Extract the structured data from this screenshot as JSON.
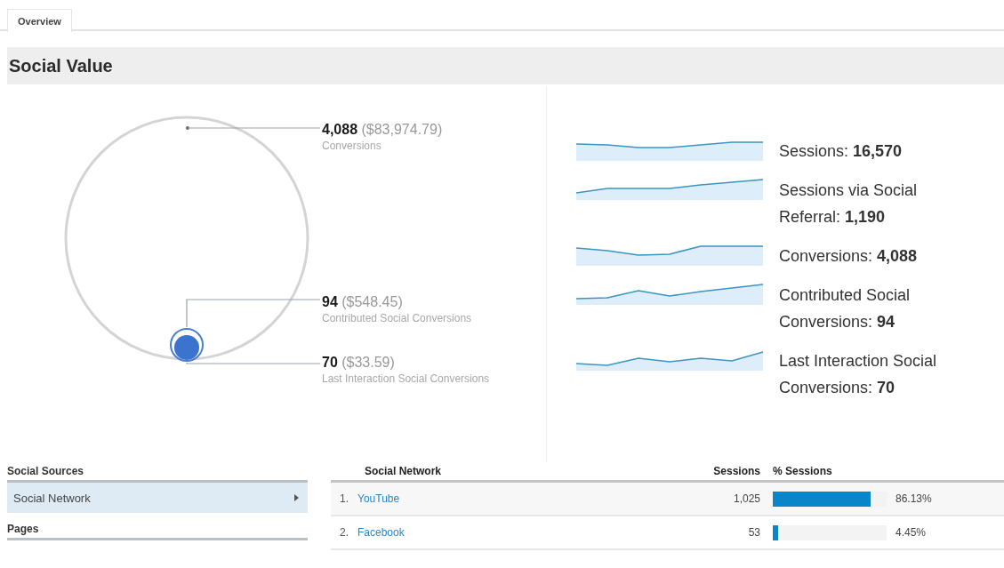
{
  "tabs": [
    {
      "label": "Overview",
      "selected": true
    }
  ],
  "header": {
    "title": "Social Value"
  },
  "circle_labels": [
    {
      "figure": "**4,088** ($83,974.79)",
      "caption": "Conversions"
    },
    {
      "figure": "**94** ($548.45)",
      "caption": "Contributed Social Conversions"
    },
    {
      "figure": "**70** ($33.59)",
      "caption": "Last Interaction Social Conversions"
    }
  ],
  "metrics": [
    {
      "text": "Sessions: **16,570**"
    },
    {
      "text": "Sessions via Social Referral: **1,190**"
    },
    {
      "text": "Conversions: **4,088**"
    },
    {
      "text": "Contributed Social Conversions: **94**"
    },
    {
      "text": "Last Interaction Social Conversions: **70**"
    }
  ],
  "sources": [
    {
      "title": "Social Sources",
      "items": [
        {
          "label": "Social Network",
          "selected": true
        }
      ]
    },
    {
      "title": "Pages"
    }
  ],
  "table": {
    "columns": [
      "Social Network",
      "Sessions",
      "% Sessions"
    ],
    "rows": [
      {
        "index": "1.",
        "name": "YouTube",
        "sessions": "1,025",
        "level": 0.8613,
        "percent": "86.13%"
      },
      {
        "index": "2.",
        "name": "Facebook",
        "sessions": "53",
        "level": 0.0445,
        "percent": "4.45%"
      }
    ]
  }
}
